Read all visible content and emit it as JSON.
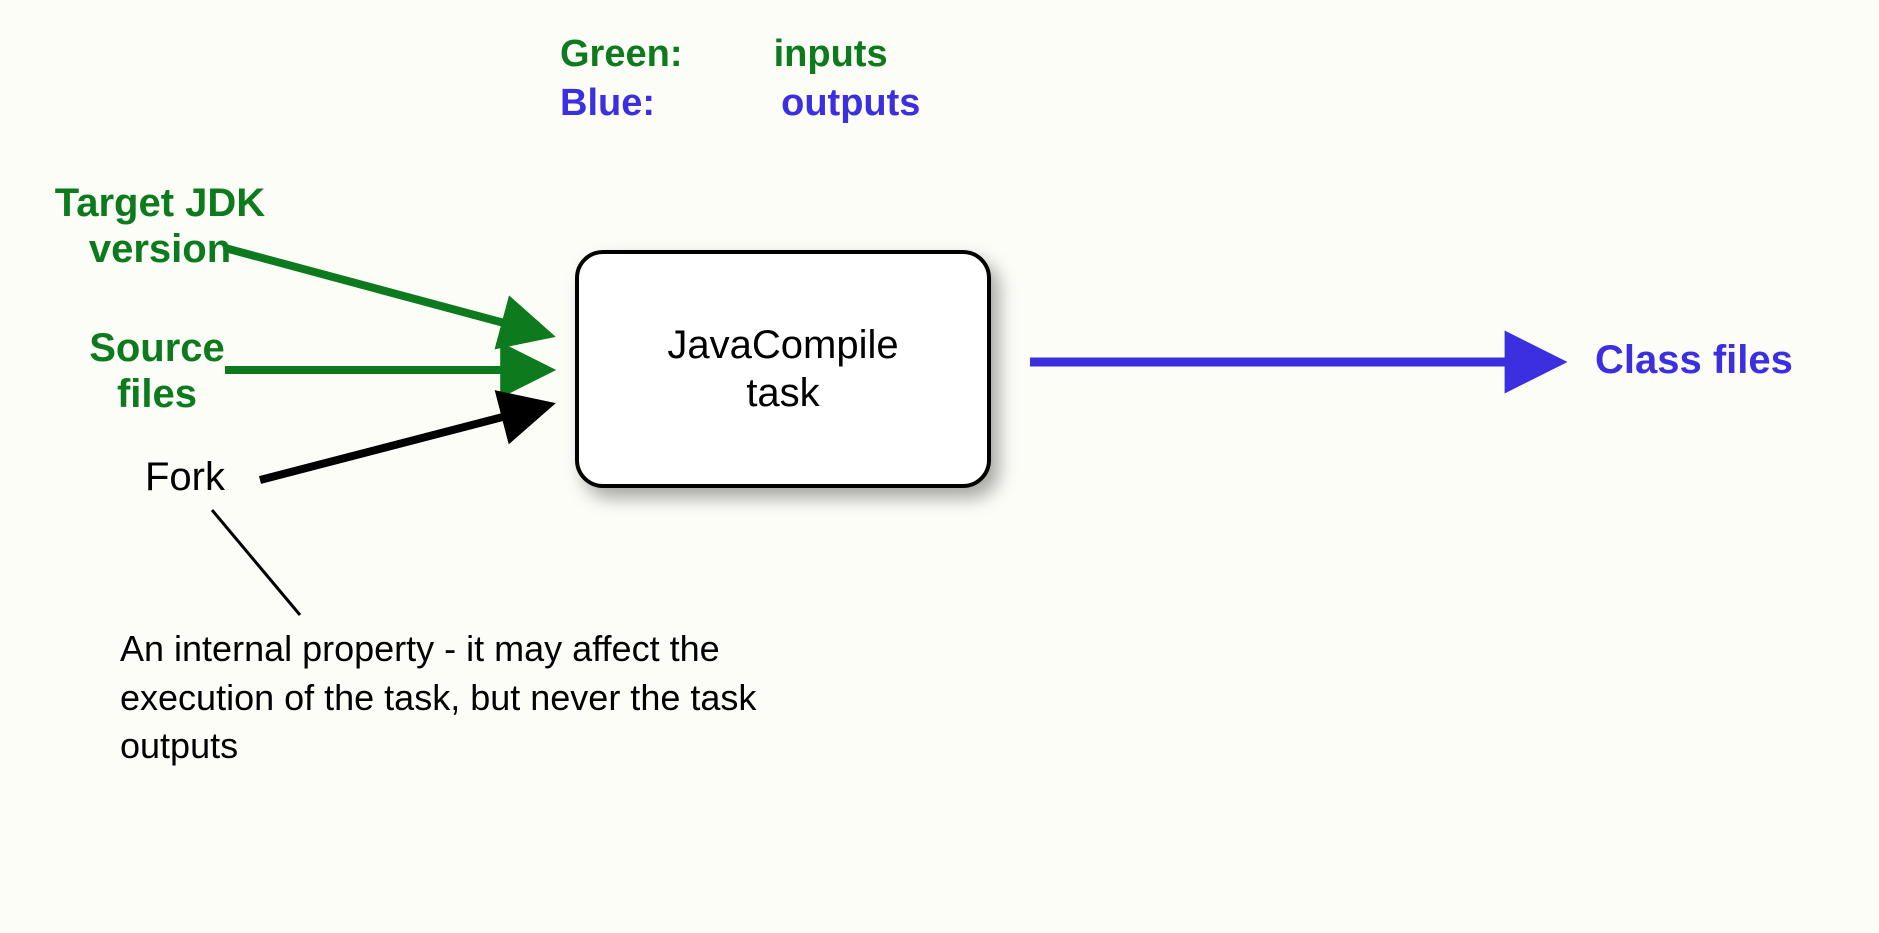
{
  "legend": {
    "green_label": "Green:",
    "green_value": "inputs",
    "blue_label": "Blue:",
    "blue_value": "outputs"
  },
  "inputs": {
    "target_jdk": "Target JDK\nversion",
    "source_files": "Source\nfiles",
    "fork": "Fork"
  },
  "task": {
    "name": "JavaCompile\ntask"
  },
  "outputs": {
    "class_files": "Class files"
  },
  "note": {
    "text": "An internal property - it may affect the execution of the task, but never the task outputs"
  },
  "colors": {
    "green": "#0c7a1d",
    "blue": "#3b2fe0",
    "black": "#000000"
  }
}
